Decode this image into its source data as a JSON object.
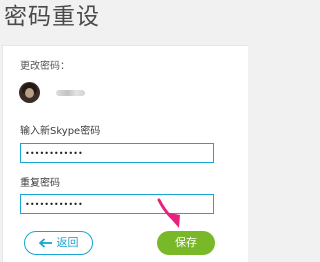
{
  "page": {
    "title": "密码重设"
  },
  "account": {
    "section_label": "更改密码："
  },
  "form": {
    "new_password_label": "输入新Skype密码",
    "new_password_value": "••••••••••••",
    "repeat_password_label": "重复密码",
    "repeat_password_value": "••••••••••••"
  },
  "actions": {
    "back_label": "返回",
    "save_label": "保存"
  },
  "icons": {
    "back": "arrow-left-icon",
    "pointer": "annotation-arrow-icon"
  },
  "colors": {
    "accent": "#19a5d3",
    "save_button": "#79b929",
    "annotation_arrow": "#e8207e"
  }
}
